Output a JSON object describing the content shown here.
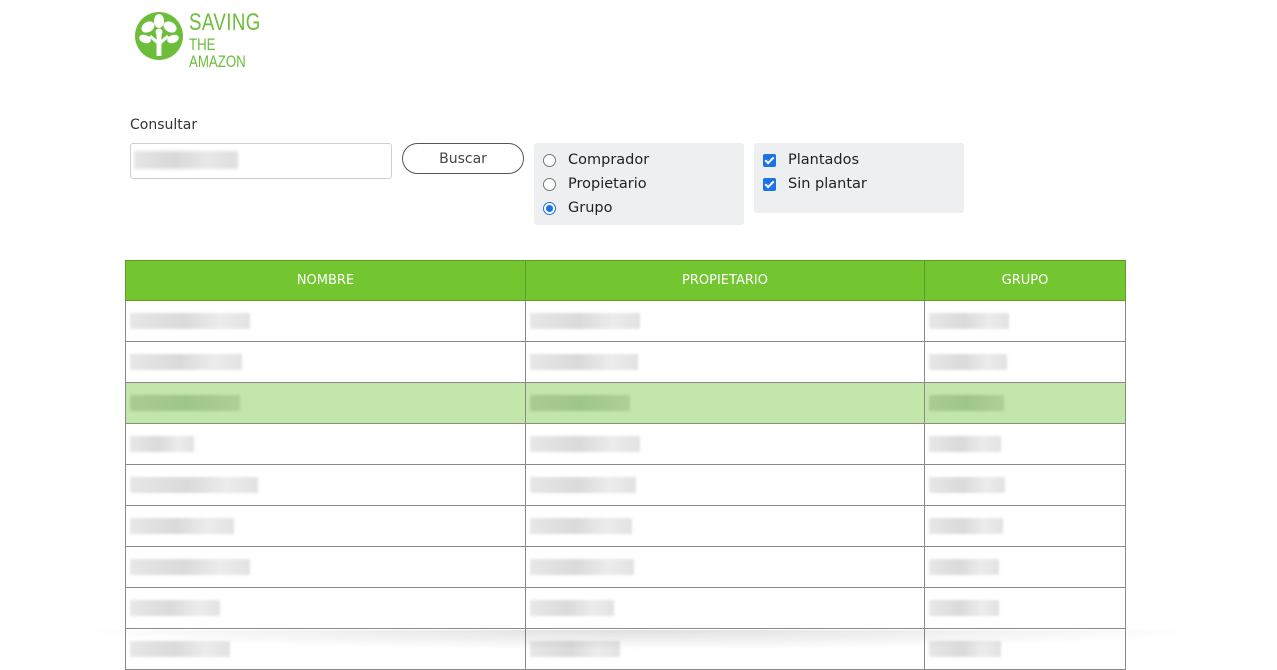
{
  "logo": {
    "line1": "SAVING",
    "line2": "THE AMAZON"
  },
  "search": {
    "label": "Consultar",
    "value": "",
    "placeholder": "",
    "button_label": "Buscar"
  },
  "radio_options": [
    {
      "label": "Comprador",
      "checked": false
    },
    {
      "label": "Propietario",
      "checked": false
    },
    {
      "label": "Grupo",
      "checked": true
    }
  ],
  "check_options": [
    {
      "label": "Plantados",
      "checked": true
    },
    {
      "label": "Sin plantar",
      "checked": true
    }
  ],
  "table": {
    "headers": [
      "NOMBRE",
      "PROPIETARIO",
      "GRUPO"
    ],
    "rows": [
      {
        "nombre": "",
        "propietario": "",
        "grupo": ""
      },
      {
        "nombre": "",
        "propietario": "",
        "grupo": ""
      },
      {
        "nombre": "",
        "propietario": "",
        "grupo": ""
      },
      {
        "nombre": "",
        "propietario": "",
        "grupo": ""
      },
      {
        "nombre": "",
        "propietario": "",
        "grupo": ""
      },
      {
        "nombre": "",
        "propietario": "",
        "grupo": ""
      },
      {
        "nombre": "",
        "propietario": "",
        "grupo": ""
      },
      {
        "nombre": "",
        "propietario": "",
        "grupo": ""
      },
      {
        "nombre": "",
        "propietario": "",
        "grupo": ""
      }
    ],
    "selected_row": 2
  },
  "colors": {
    "brand_green": "#6bbd3a",
    "header_green": "#73c62f",
    "selected_row": "#c3e6aa",
    "accent_blue": "#1a73e8"
  }
}
